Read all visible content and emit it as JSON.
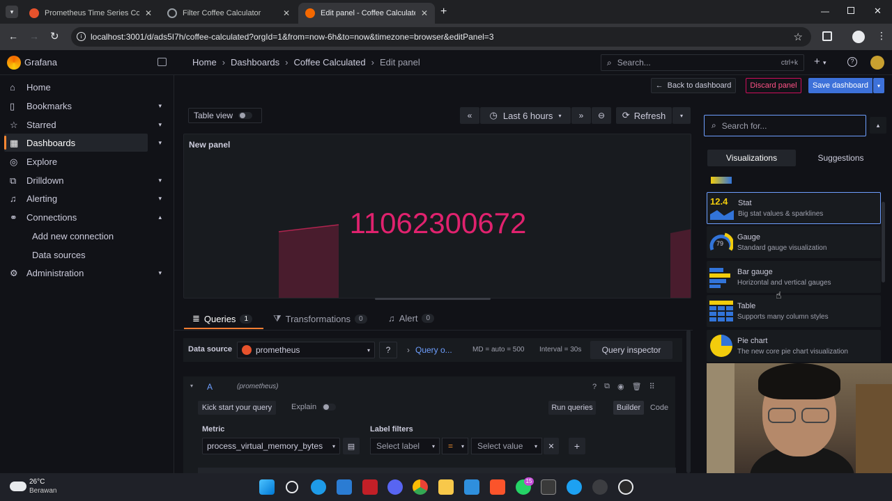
{
  "browser": {
    "tabs": [
      {
        "title": "Prometheus Time Series Collection",
        "color": "#e6522c"
      },
      {
        "title": "Filter Coffee Calculator",
        "color": "#9aa0a6"
      },
      {
        "title": "Edit panel - Coffee Calculated - Dashboards - Grafana",
        "color": "#f46800"
      }
    ],
    "url": "localhost:3001/d/ads5I7h/coffee-calculated?orgId=1&from=now-6h&to=now&timezone=browser&editPanel=3"
  },
  "grafana": {
    "brand": "Grafana",
    "breadcrumb": [
      "Home",
      "Dashboards",
      "Coffee Calculated",
      "Edit panel"
    ],
    "search_placeholder": "Search...",
    "search_shortcut": "ctrl+k",
    "sidebar": {
      "items": [
        {
          "label": "Home",
          "icon": "home-icon"
        },
        {
          "label": "Bookmarks",
          "icon": "bookmark-icon"
        },
        {
          "label": "Starred",
          "icon": "star-icon"
        },
        {
          "label": "Dashboards",
          "icon": "dashboards-icon"
        },
        {
          "label": "Explore",
          "icon": "compass-icon"
        },
        {
          "label": "Drilldown",
          "icon": "drilldown-icon"
        },
        {
          "label": "Alerting",
          "icon": "bell-icon"
        },
        {
          "label": "Connections",
          "icon": "connections-icon"
        },
        {
          "label": "Add new connection"
        },
        {
          "label": "Data sources"
        },
        {
          "label": "Administration",
          "icon": "gear-icon"
        }
      ]
    },
    "toolbar": {
      "back": "Back to dashboard",
      "discard": "Discard panel",
      "save": "Save dashboard"
    },
    "panel_toolbar": {
      "table_view": "Table view",
      "time_range": "Last 6 hours",
      "refresh": "Refresh"
    },
    "panel": {
      "title": "New panel",
      "value": "11062300672",
      "value_color": "#e0226e"
    },
    "query_tabs": [
      {
        "label": "Queries",
        "count": "1"
      },
      {
        "label": "Transformations",
        "count": "0"
      },
      {
        "label": "Alert",
        "count": "0"
      }
    ],
    "query": {
      "datasource_label": "Data source",
      "datasource": "prometheus",
      "options": "Query o...",
      "md": "MD = auto = 500",
      "interval": "Interval = 30s",
      "inspector": "Query inspector",
      "ref": "A",
      "ref_ds": "(prometheus)",
      "kickstart": "Kick start your query",
      "explain": "Explain",
      "run": "Run queries",
      "builder": "Builder",
      "code": "Code",
      "metric_label": "Metric",
      "metric": "process_virtual_memory_bytes",
      "label_filters": "Label filters",
      "select_label": "Select label",
      "op": "=",
      "select_value": "Select value"
    },
    "viz_panel": {
      "search_placeholder": "Search for...",
      "tab_viz": "Visualizations",
      "tab_sugg": "Suggestions",
      "items": [
        {
          "title": "Stat",
          "desc": "Big stat values & sparklines",
          "icon": "stat-icon",
          "icon_text": "12.4"
        },
        {
          "title": "Gauge",
          "desc": "Standard gauge visualization",
          "icon": "gauge-icon",
          "icon_text": "79"
        },
        {
          "title": "Bar gauge",
          "desc": "Horizontal and vertical gauges",
          "icon": "bar-gauge-icon"
        },
        {
          "title": "Table",
          "desc": "Supports many column styles",
          "icon": "table-icon"
        },
        {
          "title": "Pie chart",
          "desc": "The new core pie chart visualization",
          "icon": "pie-chart-icon"
        }
      ]
    }
  },
  "taskbar": {
    "weather_temp": "26°C",
    "weather_desc": "Berawan",
    "badge": "15"
  }
}
